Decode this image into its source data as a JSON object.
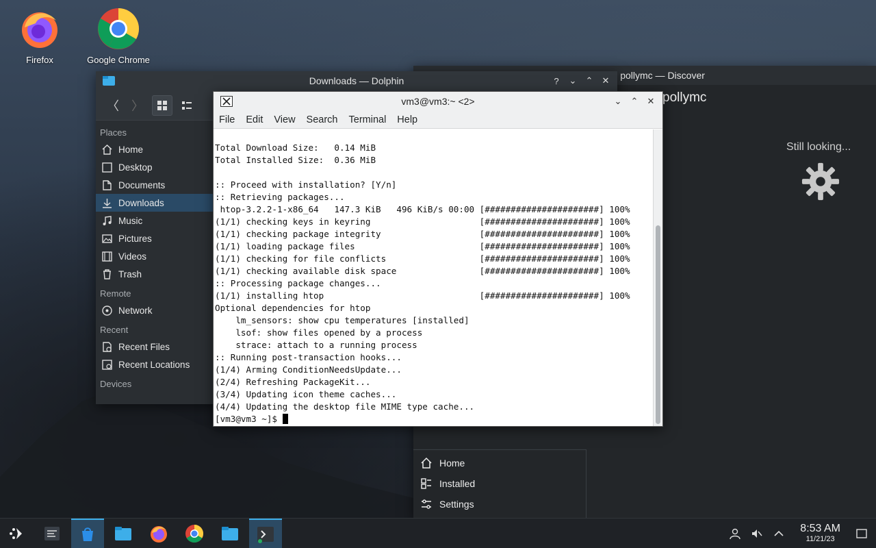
{
  "desktop": {
    "icons": [
      {
        "label": "Firefox",
        "icon": "firefox-icon"
      },
      {
        "label": "Google Chrome",
        "icon": "chrome-icon"
      }
    ]
  },
  "discover": {
    "title": "Search: pollymc — Discover",
    "search_text": "pollymc",
    "status": "Still looking...",
    "nav": [
      {
        "label": "Home",
        "icon": "home-icon"
      },
      {
        "label": "Installed",
        "icon": "installed-icon"
      },
      {
        "label": "Settings",
        "icon": "settings-icon"
      }
    ]
  },
  "dolphin": {
    "title": "Downloads — Dolphin",
    "sections": {
      "places": "Places",
      "remote": "Remote",
      "recent": "Recent",
      "devices": "Devices"
    },
    "places": [
      {
        "label": "Home",
        "icon": "home-icon"
      },
      {
        "label": "Desktop",
        "icon": "desktop-icon"
      },
      {
        "label": "Documents",
        "icon": "documents-icon"
      },
      {
        "label": "Downloads",
        "icon": "downloads-icon",
        "selected": true
      },
      {
        "label": "Music",
        "icon": "music-icon"
      },
      {
        "label": "Pictures",
        "icon": "pictures-icon"
      },
      {
        "label": "Videos",
        "icon": "videos-icon"
      },
      {
        "label": "Trash",
        "icon": "trash-icon"
      }
    ],
    "remote": [
      {
        "label": "Network",
        "icon": "network-icon"
      }
    ],
    "recent": [
      {
        "label": "Recent Files",
        "icon": "recent-files-icon"
      },
      {
        "label": "Recent Locations",
        "icon": "recent-locations-icon"
      }
    ]
  },
  "terminal": {
    "title": "vm3@vm3:~ <2>",
    "menu": [
      "File",
      "Edit",
      "View",
      "Search",
      "Terminal",
      "Help"
    ],
    "lines": [
      "Total Download Size:   0.14 MiB",
      "Total Installed Size:  0.36 MiB",
      "",
      ":: Proceed with installation? [Y/n]",
      ":: Retrieving packages...",
      " htop-3.2.2-1-x86_64   147.3 KiB   496 KiB/s 00:00 [######################] 100%",
      "(1/1) checking keys in keyring                     [######################] 100%",
      "(1/1) checking package integrity                   [######################] 100%",
      "(1/1) loading package files                        [######################] 100%",
      "(1/1) checking for file conflicts                  [######################] 100%",
      "(1/1) checking available disk space                [######################] 100%",
      ":: Processing package changes...",
      "(1/1) installing htop                              [######################] 100%",
      "Optional dependencies for htop",
      "    lm_sensors: show cpu temperatures [installed]",
      "    lsof: show files opened by a process",
      "    strace: attach to a running process",
      ":: Running post-transaction hooks...",
      "(1/4) Arming ConditionNeedsUpdate...",
      "(2/4) Refreshing PackageKit...",
      "(3/4) Updating icon theme caches...",
      "(4/4) Updating the desktop file MIME type cache..."
    ],
    "prompt": "[vm3@vm3 ~]$ "
  },
  "taskbar": {
    "apps": [
      "app-launcher-icon",
      "pager-icon",
      "discover-icon",
      "dolphin-icon",
      "firefox-icon",
      "chrome-icon",
      "dolphin-icon",
      "konsole-icon"
    ],
    "time": "8:53 AM",
    "date": "11/21/23"
  }
}
